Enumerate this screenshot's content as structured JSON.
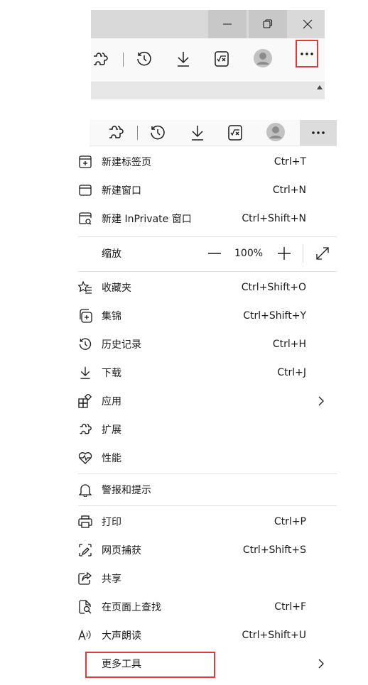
{
  "top_window": {
    "title_buttons": [
      "minimize-icon",
      "restore-icon",
      "close-icon"
    ],
    "toolbar_icons": [
      "extensions-icon",
      "history-icon",
      "download-icon",
      "math-solver-icon",
      "profile-icon",
      "more-icon"
    ],
    "highlight_color": "#e23a3a"
  },
  "toolbar2": {
    "icons": [
      "extensions-icon",
      "history-icon",
      "download-icon",
      "math-solver-icon",
      "profile-icon",
      "more-icon"
    ]
  },
  "menu": {
    "new_tab": {
      "label": "新建标签页",
      "shortcut": "Ctrl+T"
    },
    "new_window": {
      "label": "新建窗口",
      "shortcut": "Ctrl+N"
    },
    "new_inprivate": {
      "label": "新建 InPrivate 窗口",
      "shortcut": "Ctrl+Shift+N"
    },
    "zoom": {
      "label": "缩放",
      "value": "100%"
    },
    "favorites": {
      "label": "收藏夹",
      "shortcut": "Ctrl+Shift+O"
    },
    "collections": {
      "label": "集锦",
      "shortcut": "Ctrl+Shift+Y"
    },
    "history": {
      "label": "历史记录",
      "shortcut": "Ctrl+H"
    },
    "downloads": {
      "label": "下载",
      "shortcut": "Ctrl+J"
    },
    "apps": {
      "label": "应用"
    },
    "extensions": {
      "label": "扩展"
    },
    "performance": {
      "label": "性能"
    },
    "alerts": {
      "label": "警报和提示"
    },
    "print": {
      "label": "打印",
      "shortcut": "Ctrl+P"
    },
    "web_capture": {
      "label": "网页捕获",
      "shortcut": "Ctrl+Shift+S"
    },
    "share": {
      "label": "共享"
    },
    "find": {
      "label": "在页面上查找",
      "shortcut": "Ctrl+F"
    },
    "read_aloud": {
      "label": "大声朗读",
      "shortcut": "Ctrl+Shift+U"
    },
    "more_tools": {
      "label": "更多工具"
    }
  }
}
